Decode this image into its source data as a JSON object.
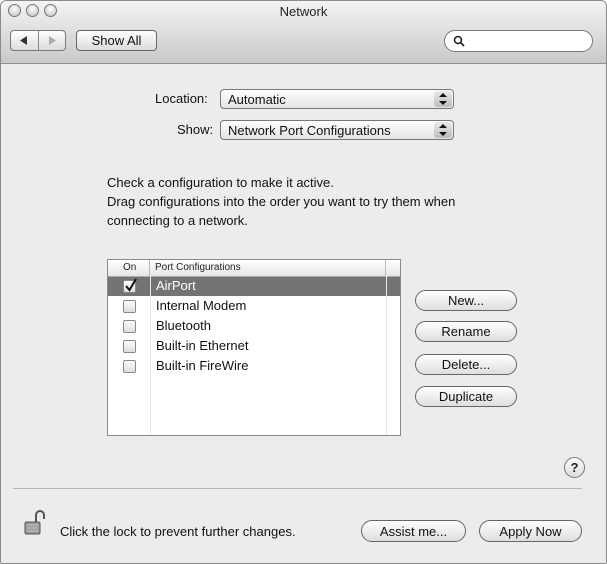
{
  "window": {
    "title": "Network"
  },
  "toolbar": {
    "show_all_label": "Show All",
    "search_value": ""
  },
  "location": {
    "label": "Location:",
    "value": "Automatic"
  },
  "show": {
    "label": "Show:",
    "value": "Network Port Configurations"
  },
  "instructions": {
    "line1": "Check a configuration to make it active.",
    "line2": "Drag configurations into the order you want to try them when",
    "line3": "connecting to a network."
  },
  "table": {
    "headers": {
      "on": "On",
      "port": "Port Configurations"
    },
    "rows": [
      {
        "name": "AirPort",
        "checked": true,
        "selected": true
      },
      {
        "name": "Internal Modem",
        "checked": false,
        "selected": false
      },
      {
        "name": "Bluetooth",
        "checked": false,
        "selected": false
      },
      {
        "name": "Built-in Ethernet",
        "checked": false,
        "selected": false
      },
      {
        "name": "Built-in FireWire",
        "checked": false,
        "selected": false
      }
    ]
  },
  "actions": {
    "new": "New...",
    "rename": "Rename",
    "delete": "Delete...",
    "duplicate": "Duplicate"
  },
  "help": {
    "label": "?"
  },
  "footer": {
    "lock_text": "Click the lock to prevent further changes.",
    "assist": "Assist me...",
    "apply": "Apply Now"
  },
  "icons": {
    "back": "left-arrow-icon",
    "forward": "right-arrow-icon",
    "search": "search-icon",
    "lock": "lock-icon",
    "checkmark": "checkmark-icon"
  },
  "colors": {
    "selection": "#737373",
    "window_bg": "#ececec"
  }
}
